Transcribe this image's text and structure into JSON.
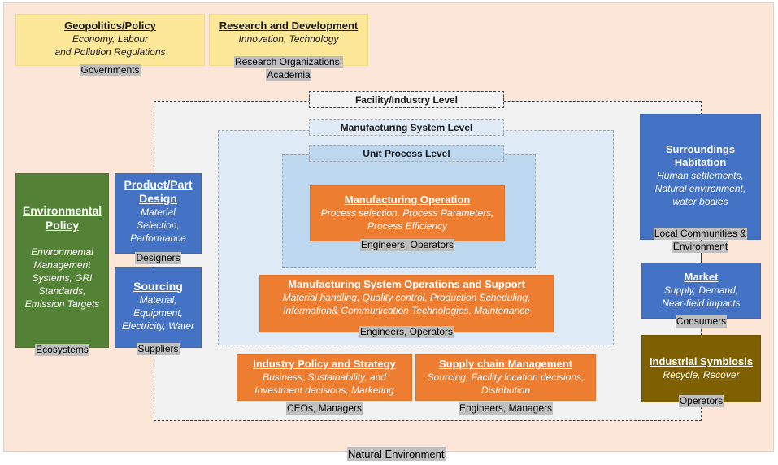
{
  "diagram": {
    "outer_label": "Natural Environment",
    "levels": {
      "facility": "Facility/Industry Level",
      "manufacturing_system": "Manufacturing System Level",
      "unit_process": "Unit Process Level"
    },
    "boxes": {
      "geopolitics": {
        "title": "Geopolitics/Policy",
        "subtitle_lines": [
          "Economy, Labour",
          "and Pollution Regulations"
        ],
        "stakeholder": "Governments",
        "color": "#fde89a"
      },
      "research": {
        "title": "Research and Development",
        "subtitle_lines": [
          "Innovation, Technology"
        ],
        "stakeholder_lines": [
          "Research Organizations,",
          "Academia"
        ],
        "color": "#fde89a"
      },
      "environmental_policy": {
        "title_lines": [
          "Environmental",
          "Policy"
        ],
        "subtitle_lines": [
          "Environmental",
          "Management",
          "Systems, GRI",
          "Standards,",
          "Emission Targets"
        ],
        "stakeholder": "Ecosystems",
        "color": "#538135"
      },
      "product_design": {
        "title_lines": [
          "Product/Part",
          "Design"
        ],
        "subtitle_lines": [
          "Material",
          "Selection,",
          "Performance"
        ],
        "stakeholder": "Designers",
        "color": "#4472c4"
      },
      "sourcing": {
        "title": "Sourcing",
        "subtitle_lines": [
          "Material,",
          "Equipment,",
          "Electricity, Water"
        ],
        "stakeholder": "Suppliers",
        "color": "#4472c4"
      },
      "manufacturing_operation": {
        "title": "Manufacturing Operation",
        "subtitle_lines": [
          "Process selection, Process Parameters,",
          "Process Efficiency"
        ],
        "stakeholder": "Engineers, Operators",
        "color": "#ed7d31"
      },
      "mso_support": {
        "title": "Manufacturing System Operations and Support",
        "subtitle_lines": [
          "Material handling, Quality control, Production Scheduling,",
          "Information& Communication Technologies, Maintenance"
        ],
        "stakeholder": "Engineers, Operators",
        "color": "#ed7d31"
      },
      "industry_policy": {
        "title": "Industry Policy and Strategy",
        "subtitle_lines": [
          "Business, Sustainability, and",
          "Investment decisions, Marketing"
        ],
        "stakeholder": "CEOs, Managers",
        "color": "#ed7d31"
      },
      "supply_chain": {
        "title": "Supply chain Management",
        "subtitle_lines": [
          "Sourcing, Facility location decisions,",
          "Distribution"
        ],
        "stakeholder": "Engineers, Managers",
        "color": "#ed7d31"
      },
      "surroundings": {
        "title_lines": [
          "Surroundings",
          "Habitation"
        ],
        "subtitle_lines": [
          "Human settlements,",
          "Natural environment,",
          "water bodies"
        ],
        "stakeholder_lines": [
          "Local Communities &",
          "Environment"
        ],
        "color": "#4472c4"
      },
      "market": {
        "title": "Market",
        "subtitle_lines": [
          "Supply, Demand,",
          "Near-field impacts"
        ],
        "stakeholder": "Consumers",
        "color": "#4472c4"
      },
      "industrial_symbiosis": {
        "title": "Industrial Symbiosis",
        "subtitle_lines": [
          "Recycle, Recover"
        ],
        "stakeholder": "Operators",
        "color": "#7f6000"
      }
    }
  }
}
